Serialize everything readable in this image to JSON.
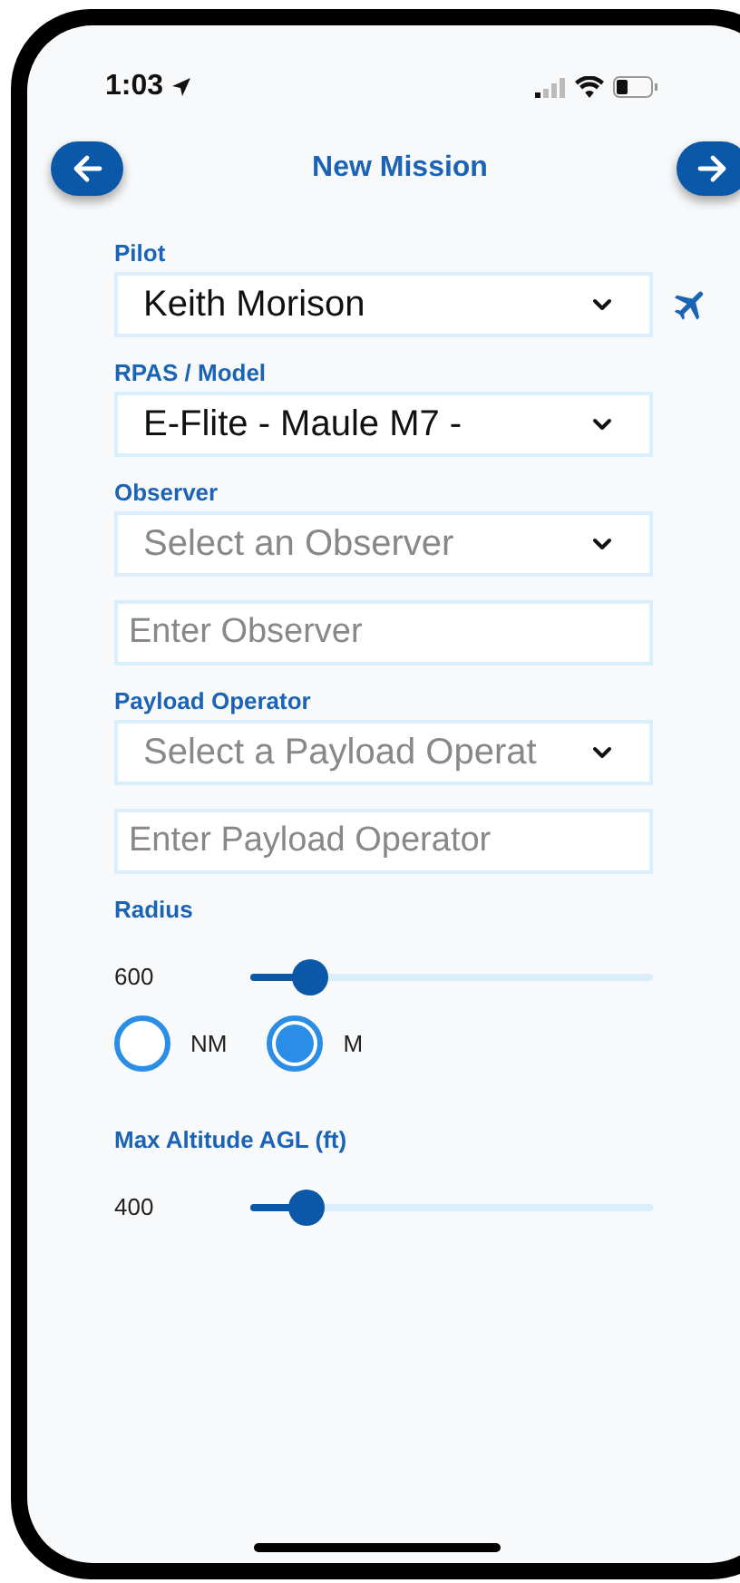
{
  "status_bar": {
    "time": "1:03"
  },
  "header": {
    "title": "New Mission"
  },
  "form": [
    {
      "kind": "label",
      "text": "Pilot"
    },
    {
      "kind": "select",
      "value": "Keith Morison",
      "action_button": true
    },
    {
      "kind": "label",
      "text": "RPAS / Model"
    },
    {
      "kind": "select",
      "value": "E-Flite - Maule M7 -"
    },
    {
      "kind": "label",
      "text": "Observer"
    },
    {
      "kind": "select",
      "placeholder": "Select an Observer"
    },
    {
      "kind": "input",
      "placeholder": "Enter Observer"
    },
    {
      "kind": "label",
      "text": "Payload Operator"
    },
    {
      "kind": "select",
      "placeholder": "Select a Payload Operat"
    },
    {
      "kind": "input",
      "placeholder": "Enter Payload Operator"
    },
    {
      "kind": "label",
      "text": "Radius"
    },
    {
      "kind": "slider",
      "reading": "600",
      "level": 0.15
    },
    {
      "kind": "radios",
      "options": [
        {
          "label": "NM",
          "selected": false
        },
        {
          "label": "M",
          "selected": true
        }
      ]
    },
    {
      "kind": "label",
      "text": "Max Altitude AGL (ft)"
    },
    {
      "kind": "slider",
      "reading": "400",
      "level": 0.14
    }
  ]
}
